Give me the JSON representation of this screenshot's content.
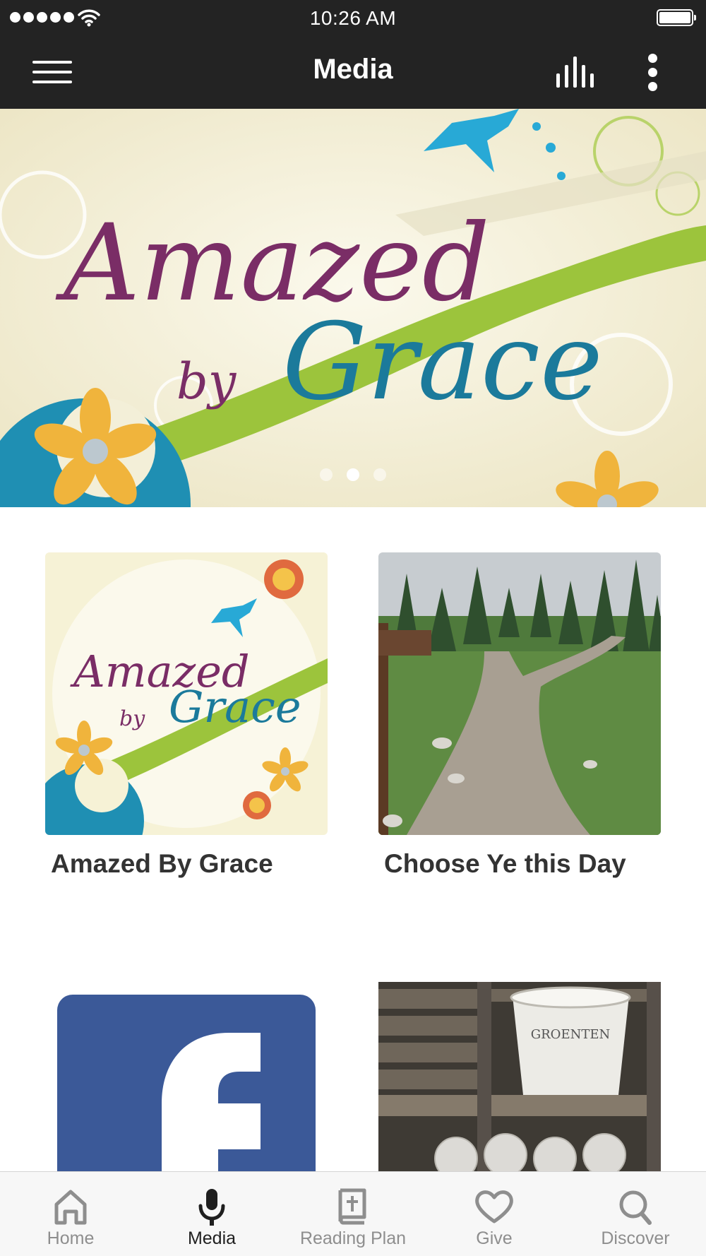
{
  "status_bar": {
    "time": "10:26 AM"
  },
  "nav": {
    "title": "Media",
    "menu_icon": "hamburger-menu-icon",
    "audio_icon": "audio-bars-icon",
    "more_icon": "more-vertical-icon"
  },
  "hero": {
    "image_text_line1": "Amazed",
    "image_text_line2": "by",
    "image_text_line3": "Grace",
    "page_count": 3,
    "active_page": 2
  },
  "grid": {
    "items": [
      {
        "title": "Amazed By Grace",
        "art_line1": "Amazed",
        "art_line2": "by",
        "art_line3": "Grace"
      },
      {
        "title": "Choose Ye this Day"
      },
      {
        "title": "",
        "icon": "facebook-logo"
      },
      {
        "title": "",
        "art_label": "GROENTEN"
      }
    ]
  },
  "tabs": [
    {
      "label": "Home",
      "icon": "home-icon",
      "active": false
    },
    {
      "label": "Media",
      "icon": "microphone-icon",
      "active": true
    },
    {
      "label": "Reading Plan",
      "icon": "bible-icon",
      "active": false
    },
    {
      "label": "Give",
      "icon": "heart-icon",
      "active": false
    },
    {
      "label": "Discover",
      "icon": "search-icon",
      "active": false
    }
  ],
  "colors": {
    "bar_background": "#232323",
    "tab_active": "#1f1f1f",
    "tab_inactive": "#8e8e8e",
    "facebook_blue": "#3b5998"
  }
}
